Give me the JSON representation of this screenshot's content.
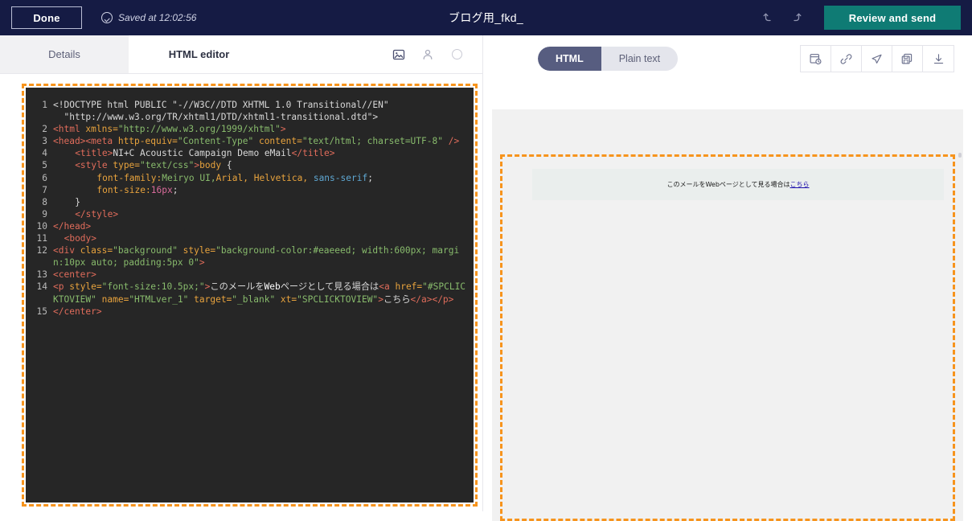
{
  "topbar": {
    "done_label": "Done",
    "saved_label": "Saved at 12:02:56",
    "saved_icon": "check-circle-icon",
    "document_title": "ブログ用_fkd_",
    "undo_icon": "undo-arrow-icon",
    "redo_icon": "redo-arrow-icon",
    "review_label": "Review and send",
    "accent_bg": "#151b44",
    "review_bg": "#0f7b74"
  },
  "left_pane": {
    "tabs": [
      {
        "label": "Details",
        "active": false
      },
      {
        "label": "HTML editor",
        "active": true
      }
    ],
    "tab_icons": [
      {
        "name": "image-placeholder-icon"
      },
      {
        "name": "person-icon"
      },
      {
        "name": "circle-icon"
      }
    ],
    "editor": {
      "border_color": "#f7941d",
      "background": "#262626",
      "lines": [
        {
          "number": "1",
          "tokens": [
            {
              "t": "plain",
              "v": "<!DOCTYPE html PUBLIC \"-//W3C//DTD XHTML 1.0 Transitional//EN\"\n  \"http://www.w3.org/TR/xhtml1/DTD/xhtml1-transitional.dtd\">"
            }
          ]
        },
        {
          "number": "2",
          "tokens": [
            {
              "t": "tag",
              "v": "<html "
            },
            {
              "t": "attr",
              "v": "xmlns="
            },
            {
              "t": "str",
              "v": "\"http://www.w3.org/1999/xhtml\""
            },
            {
              "t": "tag",
              "v": ">"
            }
          ]
        },
        {
          "number": "3",
          "tokens": [
            {
              "t": "tag",
              "v": "<head><meta "
            },
            {
              "t": "attr",
              "v": "http-equiv="
            },
            {
              "t": "str",
              "v": "\"Content-Type\""
            },
            {
              "t": "attr",
              "v": " content="
            },
            {
              "t": "str",
              "v": "\"text/html; charset=UTF-8\""
            },
            {
              "t": "tag",
              "v": " />"
            }
          ]
        },
        {
          "number": "4",
          "indent": 4,
          "tokens": [
            {
              "t": "tag",
              "v": "<title>"
            },
            {
              "t": "plain",
              "v": "NI+C Acoustic Campaign Demo eMail"
            },
            {
              "t": "tag",
              "v": "</title>"
            }
          ]
        },
        {
          "number": "5",
          "indent": 4,
          "tokens": [
            {
              "t": "tag",
              "v": "<style "
            },
            {
              "t": "attr",
              "v": "type="
            },
            {
              "t": "str",
              "v": "\"text/css\""
            },
            {
              "t": "tag",
              "v": ">"
            },
            {
              "t": "prop",
              "v": "body "
            },
            {
              "t": "plain",
              "v": "{"
            }
          ]
        },
        {
          "number": "6",
          "indent": 8,
          "tokens": [
            {
              "t": "prop",
              "v": "font-family:"
            },
            {
              "t": "str",
              "v": "Meiryo UI,"
            },
            {
              "t": "prop",
              "v": "Arial, Helvetica, "
            },
            {
              "t": "kw",
              "v": "sans-serif"
            },
            {
              "t": "plain",
              "v": ";"
            }
          ]
        },
        {
          "number": "7",
          "indent": 8,
          "tokens": [
            {
              "t": "prop",
              "v": "font-size:"
            },
            {
              "t": "num",
              "v": "16px"
            },
            {
              "t": "plain",
              "v": ";"
            }
          ]
        },
        {
          "number": "8",
          "indent": 4,
          "tokens": [
            {
              "t": "plain",
              "v": "}"
            }
          ]
        },
        {
          "number": "9",
          "indent": 4,
          "tokens": [
            {
              "t": "tag",
              "v": "</style>"
            }
          ]
        },
        {
          "number": "10",
          "tokens": [
            {
              "t": "tag",
              "v": "</head>"
            }
          ]
        },
        {
          "number": "11",
          "indent": 2,
          "tokens": [
            {
              "t": "tag",
              "v": "<body>"
            }
          ]
        },
        {
          "number": "12",
          "tokens": [
            {
              "t": "tag",
              "v": "<div "
            },
            {
              "t": "attr",
              "v": "class="
            },
            {
              "t": "str",
              "v": "\"background\""
            },
            {
              "t": "attr",
              "v": " style="
            },
            {
              "t": "str",
              "v": "\"background-color:#eaeeed; width:600px; margin:10px auto; padding:5px 0\""
            },
            {
              "t": "tag",
              "v": ">"
            }
          ]
        },
        {
          "number": "13",
          "tokens": [
            {
              "t": "tag",
              "v": "<center>"
            }
          ]
        },
        {
          "number": "14",
          "tokens": [
            {
              "t": "tag",
              "v": "<p "
            },
            {
              "t": "attr",
              "v": "style="
            },
            {
              "t": "str",
              "v": "\"font-size:10.5px;\""
            },
            {
              "t": "tag",
              "v": ">"
            },
            {
              "t": "plain",
              "v": "このメールを"
            },
            {
              "t": "white",
              "v": "Web"
            },
            {
              "t": "plain",
              "v": "ページとして見る場合は"
            },
            {
              "t": "tag",
              "v": "<a "
            },
            {
              "t": "attr",
              "v": "href="
            },
            {
              "t": "str",
              "v": "\"#SPCLICKTOVIEW\""
            },
            {
              "t": "attr",
              "v": " name="
            },
            {
              "t": "str",
              "v": "\"HTMLver_1\""
            },
            {
              "t": "attr",
              "v": " target="
            },
            {
              "t": "str",
              "v": "\"_blank\""
            },
            {
              "t": "attr",
              "v": " xt="
            },
            {
              "t": "str",
              "v": "\"SPCLICKTOVIEW\""
            },
            {
              "t": "tag",
              "v": ">"
            },
            {
              "t": "plain",
              "v": "こちら"
            },
            {
              "t": "tag",
              "v": "</a></p>"
            }
          ]
        },
        {
          "number": "15",
          "tokens": [
            {
              "t": "tag",
              "v": "</center>"
            }
          ]
        }
      ]
    }
  },
  "right_pane": {
    "view_toggle": [
      {
        "label": "HTML",
        "active": true
      },
      {
        "label": "Plain text",
        "active": false
      }
    ],
    "tool_icons": [
      {
        "name": "preview-schedule-icon"
      },
      {
        "name": "link-icon"
      },
      {
        "name": "send-icon"
      },
      {
        "name": "save-copy-icon"
      },
      {
        "name": "download-icon"
      }
    ],
    "preview": {
      "border_color": "#f7941d",
      "mail_background": "#eaeeed",
      "text_before_link": "このメールをWebページとして見る場合は",
      "link_text": "こちら"
    }
  }
}
